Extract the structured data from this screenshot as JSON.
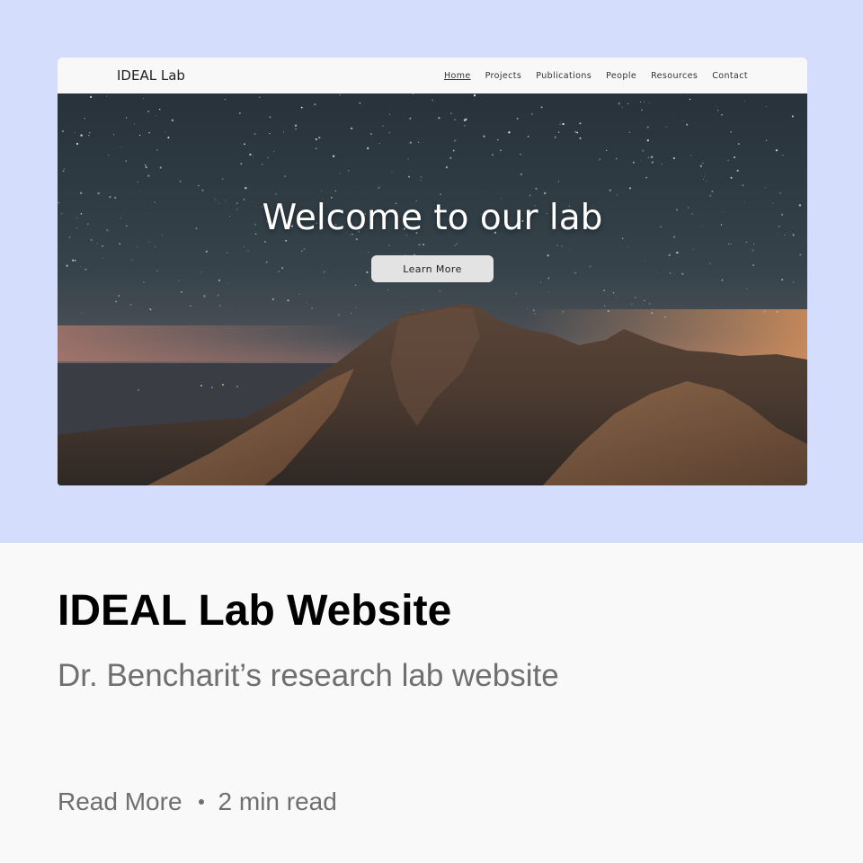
{
  "preview": {
    "site_title": "IDEAL Lab",
    "nav": [
      "Home",
      "Projects",
      "Publications",
      "People",
      "Resources",
      "Contact"
    ],
    "active_nav": "Home",
    "hero_title": "Welcome to our lab",
    "hero_button": "Learn More"
  },
  "card": {
    "title": "IDEAL Lab Website",
    "subtitle": "Dr. Bencharit’s research lab website",
    "read_more": "Read More",
    "read_time": "2 min read"
  },
  "colors": {
    "card_top_bg": "#d4defc",
    "page_bg": "#f9f9f9",
    "subtitle_text": "#6f6f6f"
  }
}
